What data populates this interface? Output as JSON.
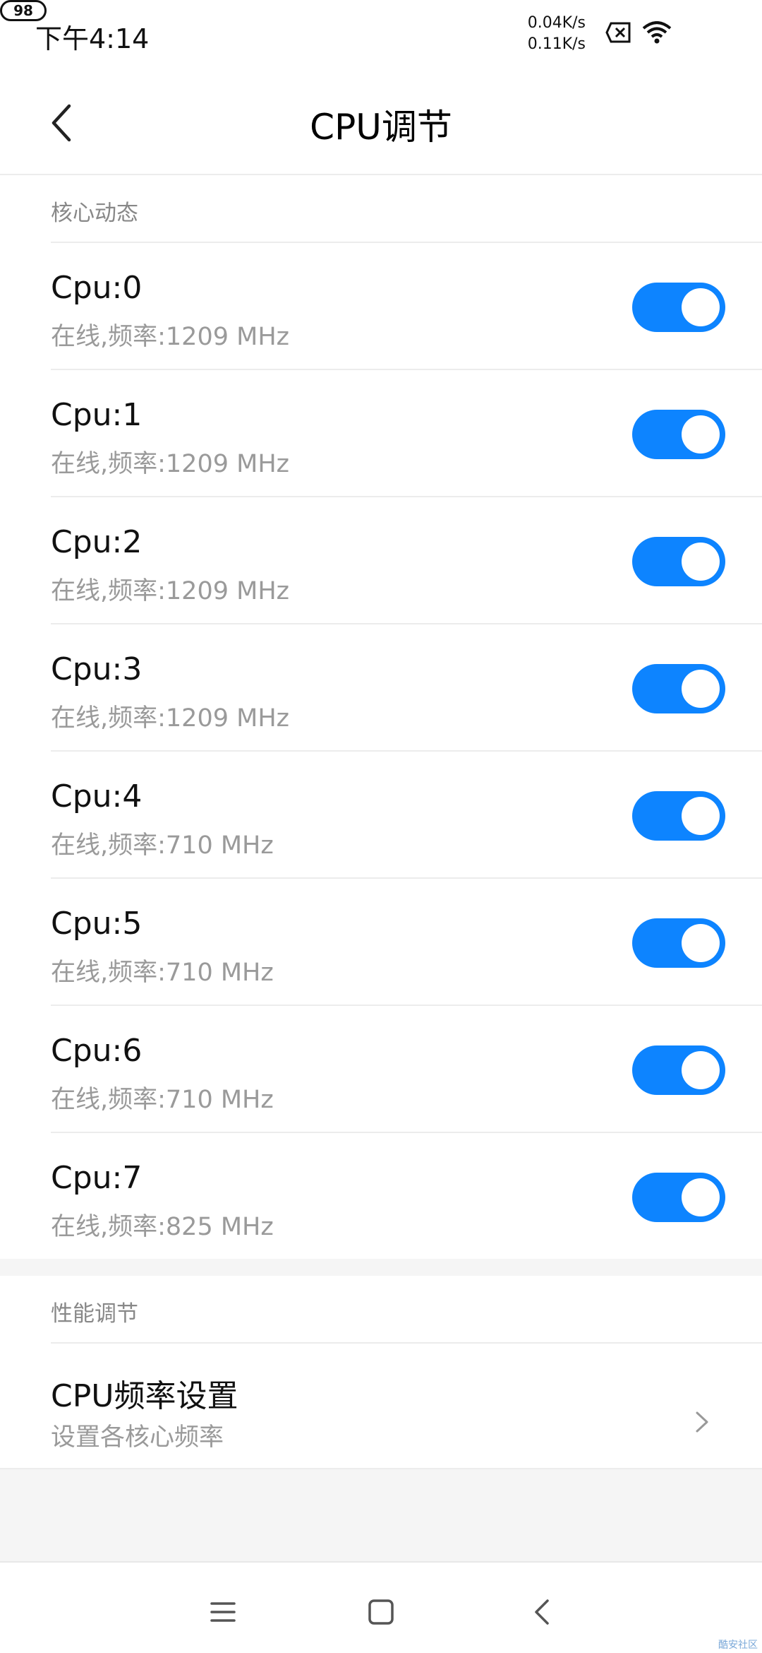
{
  "status_bar": {
    "time": "下午4:14",
    "net_up": "0.04K/s",
    "net_down": "0.11K/s",
    "battery": "98",
    "icons": [
      "sim-x-icon",
      "wifi-icon",
      "battery-icon"
    ]
  },
  "header": {
    "title": "CPU调节",
    "back_icon": "back-arrow-icon"
  },
  "core_section": {
    "label": "核心动态",
    "items": [
      {
        "title": "Cpu:0",
        "subtitle": "在线,频率:1209 MHz",
        "enabled": true
      },
      {
        "title": "Cpu:1",
        "subtitle": "在线,频率:1209 MHz",
        "enabled": true
      },
      {
        "title": "Cpu:2",
        "subtitle": "在线,频率:1209 MHz",
        "enabled": true
      },
      {
        "title": "Cpu:3",
        "subtitle": "在线,频率:1209 MHz",
        "enabled": true
      },
      {
        "title": "Cpu:4",
        "subtitle": "在线,频率:710 MHz",
        "enabled": true
      },
      {
        "title": "Cpu:5",
        "subtitle": "在线,频率:710 MHz",
        "enabled": true
      },
      {
        "title": "Cpu:6",
        "subtitle": "在线,频率:710 MHz",
        "enabled": true
      },
      {
        "title": "Cpu:7",
        "subtitle": "在线,频率:825 MHz",
        "enabled": true
      }
    ]
  },
  "perf_section": {
    "label": "性能调节",
    "item": {
      "title": "CPU频率设置",
      "subtitle": "设置各核心频率",
      "icon": "chevron-right-icon"
    }
  },
  "nav_bar": {
    "icons": [
      "menu-icon",
      "home-icon",
      "back-icon"
    ]
  },
  "watermark": "酷安社区",
  "colors": {
    "accent": "#0d84ff",
    "background_gray": "#f5f5f5"
  }
}
